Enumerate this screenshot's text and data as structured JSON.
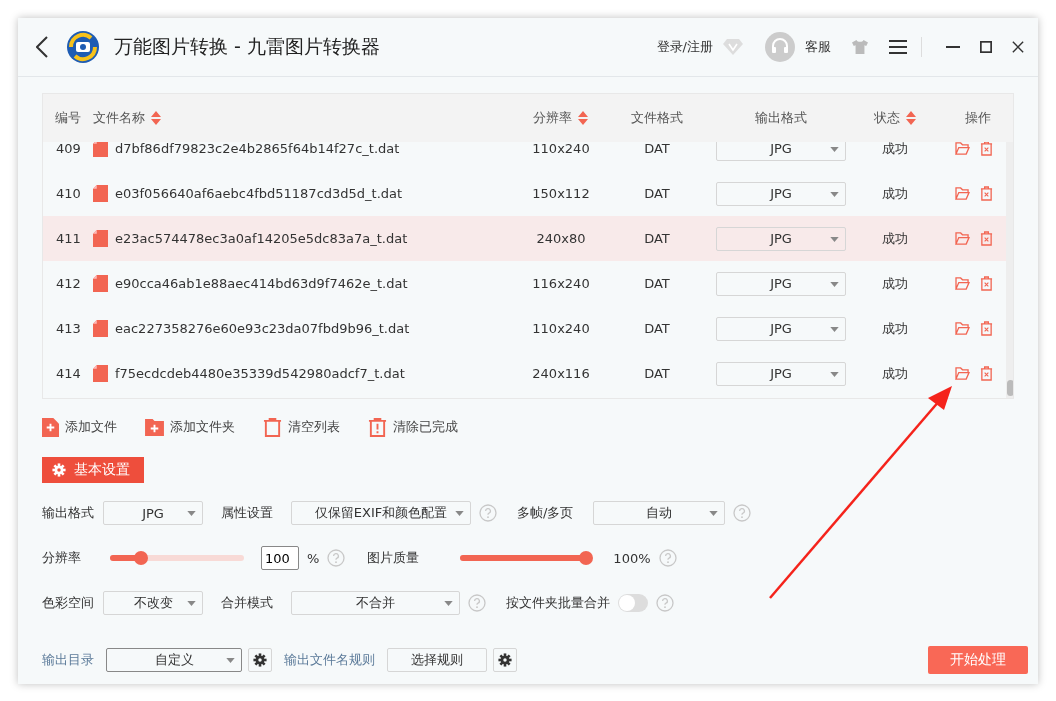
{
  "window": {
    "title": "万能图片转换 - 九雷图片转换器",
    "login": "登录/注册",
    "service": "客服"
  },
  "table": {
    "columns": [
      {
        "label": "编号",
        "sortable": false
      },
      {
        "label": "文件名称",
        "sortable": true
      },
      {
        "label": "分辨率",
        "sortable": true
      },
      {
        "label": "文件格式",
        "sortable": false
      },
      {
        "label": "输出格式",
        "sortable": false
      },
      {
        "label": "状态",
        "sortable": true
      },
      {
        "label": "操作",
        "sortable": false
      }
    ],
    "rows": [
      {
        "num": "409",
        "name": "d7bf86df79823c2e4b2865f64b14f27c_t.dat",
        "resolution": "110x240",
        "format": "DAT",
        "output": "JPG",
        "status": "成功",
        "selected": false
      },
      {
        "num": "410",
        "name": "e03f056640af6aebc4fbd51187cd3d5d_t.dat",
        "resolution": "150x112",
        "format": "DAT",
        "output": "JPG",
        "status": "成功",
        "selected": false
      },
      {
        "num": "411",
        "name": "e23ac574478ec3a0af14205e5dc83a7a_t.dat",
        "resolution": "240x80",
        "format": "DAT",
        "output": "JPG",
        "status": "成功",
        "selected": true
      },
      {
        "num": "412",
        "name": "e90cca46ab1e88aec414bd63d9f7462e_t.dat",
        "resolution": "116x240",
        "format": "DAT",
        "output": "JPG",
        "status": "成功",
        "selected": false
      },
      {
        "num": "413",
        "name": "eac227358276e60e93c23da07fbd9b96_t.dat",
        "resolution": "110x240",
        "format": "DAT",
        "output": "JPG",
        "status": "成功",
        "selected": false
      },
      {
        "num": "414",
        "name": "f75ecdcdeb4480e35339d542980adcf7_t.dat",
        "resolution": "240x116",
        "format": "DAT",
        "output": "JPG",
        "status": "成功",
        "selected": false
      }
    ]
  },
  "toolbar": [
    {
      "kind": "add-file",
      "label": "添加文件"
    },
    {
      "kind": "add-folder",
      "label": "添加文件夹"
    },
    {
      "kind": "clear",
      "label": "清空列表"
    },
    {
      "kind": "clear-done",
      "label": "清除已完成"
    }
  ],
  "settings_tab": "基本设置",
  "settings": {
    "output_format": {
      "label": "输出格式",
      "value": "JPG"
    },
    "attributes": {
      "label": "属性设置",
      "value": "仅保留EXIF和颜色配置"
    },
    "multi_frame": {
      "label": "多帧/多页",
      "value": "自动"
    },
    "resolution": {
      "label": "分辨率",
      "level": 0.23,
      "value": "100",
      "unit": "%"
    },
    "quality": {
      "label": "图片质量",
      "level": 1.0,
      "reading": "100%"
    },
    "color_space": {
      "label": "色彩空间",
      "value": "不改变"
    },
    "merge_mode": {
      "label": "合并模式",
      "value": "不合并"
    },
    "merge_by_folder": {
      "label": "按文件夹批量合并",
      "on": false
    }
  },
  "footer": {
    "output_dir_label": "输出目录",
    "output_dir": "自定义",
    "name_rule_label": "输出文件名规则",
    "name_rule_button": "选择规则",
    "start": "开始处理"
  }
}
